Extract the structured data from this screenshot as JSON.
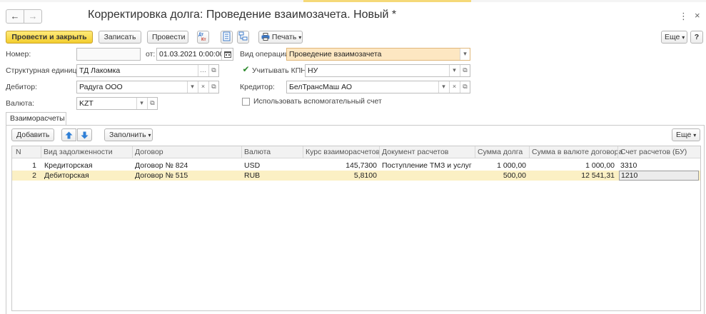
{
  "window": {
    "title": "Корректировка долга: Проведение взаимозачета. Новый *",
    "back_glyph": "←",
    "forward_glyph": "→",
    "more_glyph": "⋮",
    "close_glyph": "×"
  },
  "toolbar": {
    "post_close_label": "Провести и закрыть",
    "save_label": "Записать",
    "post_label": "Провести",
    "print_label": "Печать",
    "more_label": "Еще",
    "help_label": "?"
  },
  "form": {
    "number_label": "Номер:",
    "number_value": "",
    "date_from_label": "от:",
    "date_value": "01.03.2021  0:00:00",
    "operation_label": "Вид операции:",
    "operation_value": "Проведение взаимозачета",
    "unit_label": "Структурная единица:",
    "unit_value": "ТД Лакомка",
    "kpn_label": "Учитывать КПН",
    "kpn_checked": true,
    "kpn_value": "НУ",
    "debtor_label": "Дебитор:",
    "debtor_value": "Радуга ООО",
    "creditor_label": "Кредитор:",
    "creditor_value": "БелТрансМаш АО",
    "currency_label": "Валюта:",
    "currency_value": "KZT",
    "aux_account_label": "Использовать вспомогательный счет",
    "aux_account_checked": false
  },
  "tabs": [
    {
      "label": "Взаиморасчеты",
      "active": true
    }
  ],
  "table_toolbar": {
    "add_label": "Добавить",
    "fill_label": "Заполнить",
    "more_label": "Еще"
  },
  "table": {
    "columns": [
      "N",
      "Вид задолженности",
      "Договор",
      "Валюта",
      "Курс взаиморасчетов",
      "Документ расчетов",
      "Сумма долга",
      "Сумма в валюте договора",
      "Счет расчетов (БУ)"
    ],
    "rows": [
      {
        "n": "1",
        "debt_type": "Кредиторская",
        "contract": "Договор № 824",
        "currency": "USD",
        "rate": "145,7300",
        "document": "Поступление ТМЗ и услуг Б...",
        "amount": "1 000,00",
        "amount_contract": "1 000,00",
        "account": "3310",
        "selected": false
      },
      {
        "n": "2",
        "debt_type": "Дебиторская",
        "contract": "Договор № 515",
        "currency": "RUB",
        "rate": "5,8100",
        "document": "",
        "amount": "500,00",
        "amount_contract": "12 541,31",
        "account": "1210",
        "selected": true
      }
    ]
  },
  "colors": {
    "primary_button": "#f3cd2e",
    "highlight_field": "#fde7c2",
    "selected_row": "#fbf0c4"
  }
}
